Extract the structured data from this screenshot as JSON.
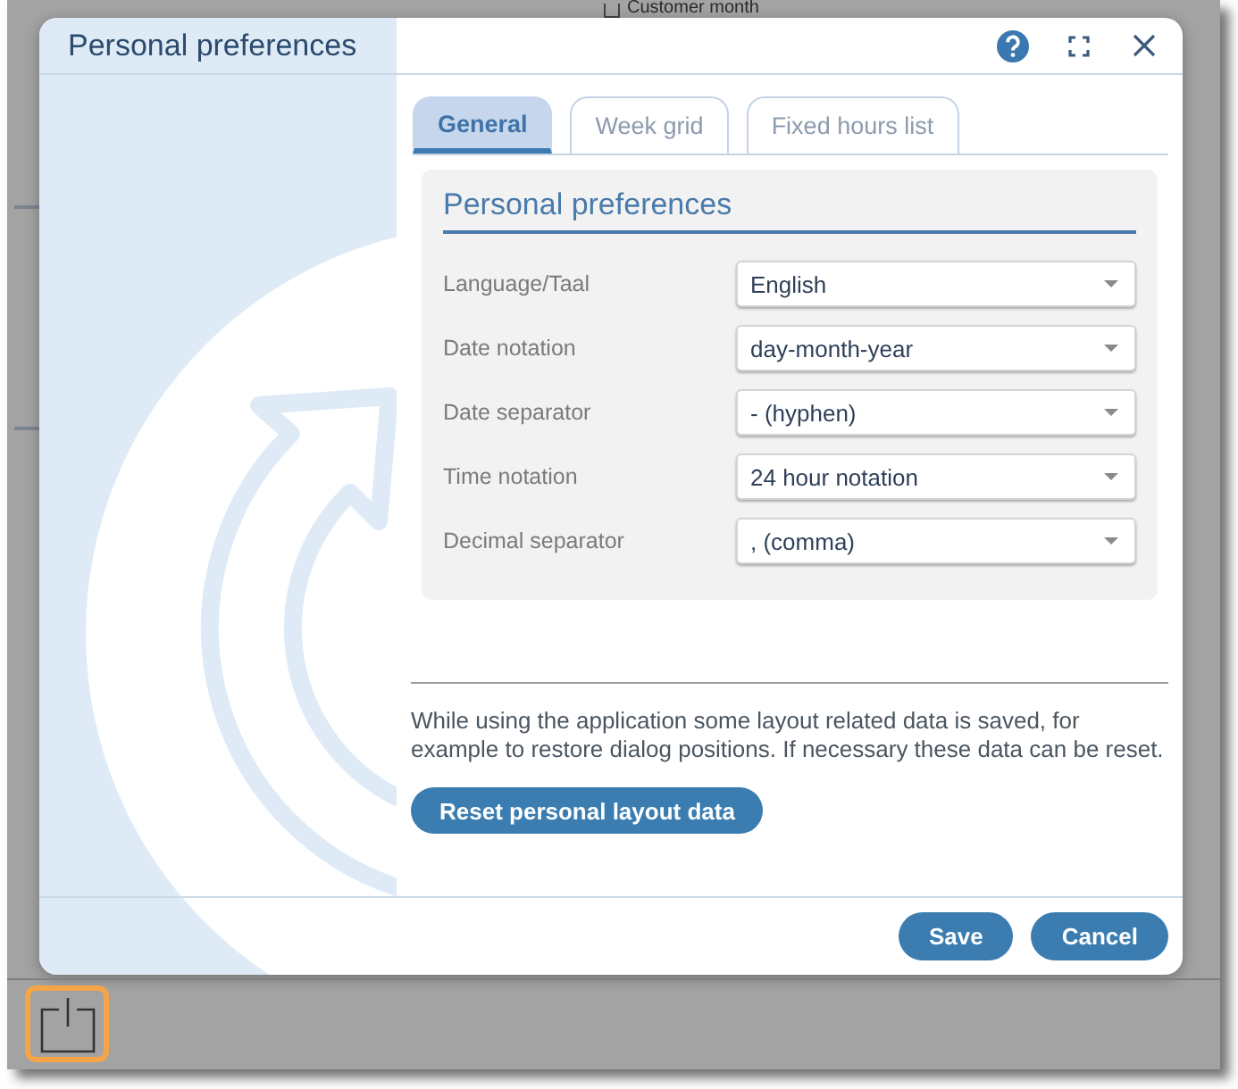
{
  "background_item": {
    "label": "Customer month"
  },
  "dialog": {
    "title": "Personal preferences",
    "tabs": [
      {
        "label": "General",
        "selected": true
      },
      {
        "label": "Week grid",
        "selected": false
      },
      {
        "label": "Fixed hours list",
        "selected": false
      }
    ],
    "section": {
      "title": "Personal preferences",
      "fields": [
        {
          "label": "Language/Taal",
          "value": "English"
        },
        {
          "label": "Date notation",
          "value": "day-month-year"
        },
        {
          "label": "Date separator",
          "value": "- (hyphen)"
        },
        {
          "label": "Time notation",
          "value": "24 hour notation"
        },
        {
          "label": "Decimal separator",
          "value": ", (comma)"
        }
      ]
    },
    "note": "While using the application some layout related data is saved, for example to restore dialog positions. If necessary these data can be reset.",
    "reset_button": "Reset personal layout data",
    "buttons": [
      {
        "label": "Save"
      },
      {
        "label": "Cancel"
      }
    ]
  },
  "taskbar": {
    "button": {
      "highlighted": true
    }
  }
}
